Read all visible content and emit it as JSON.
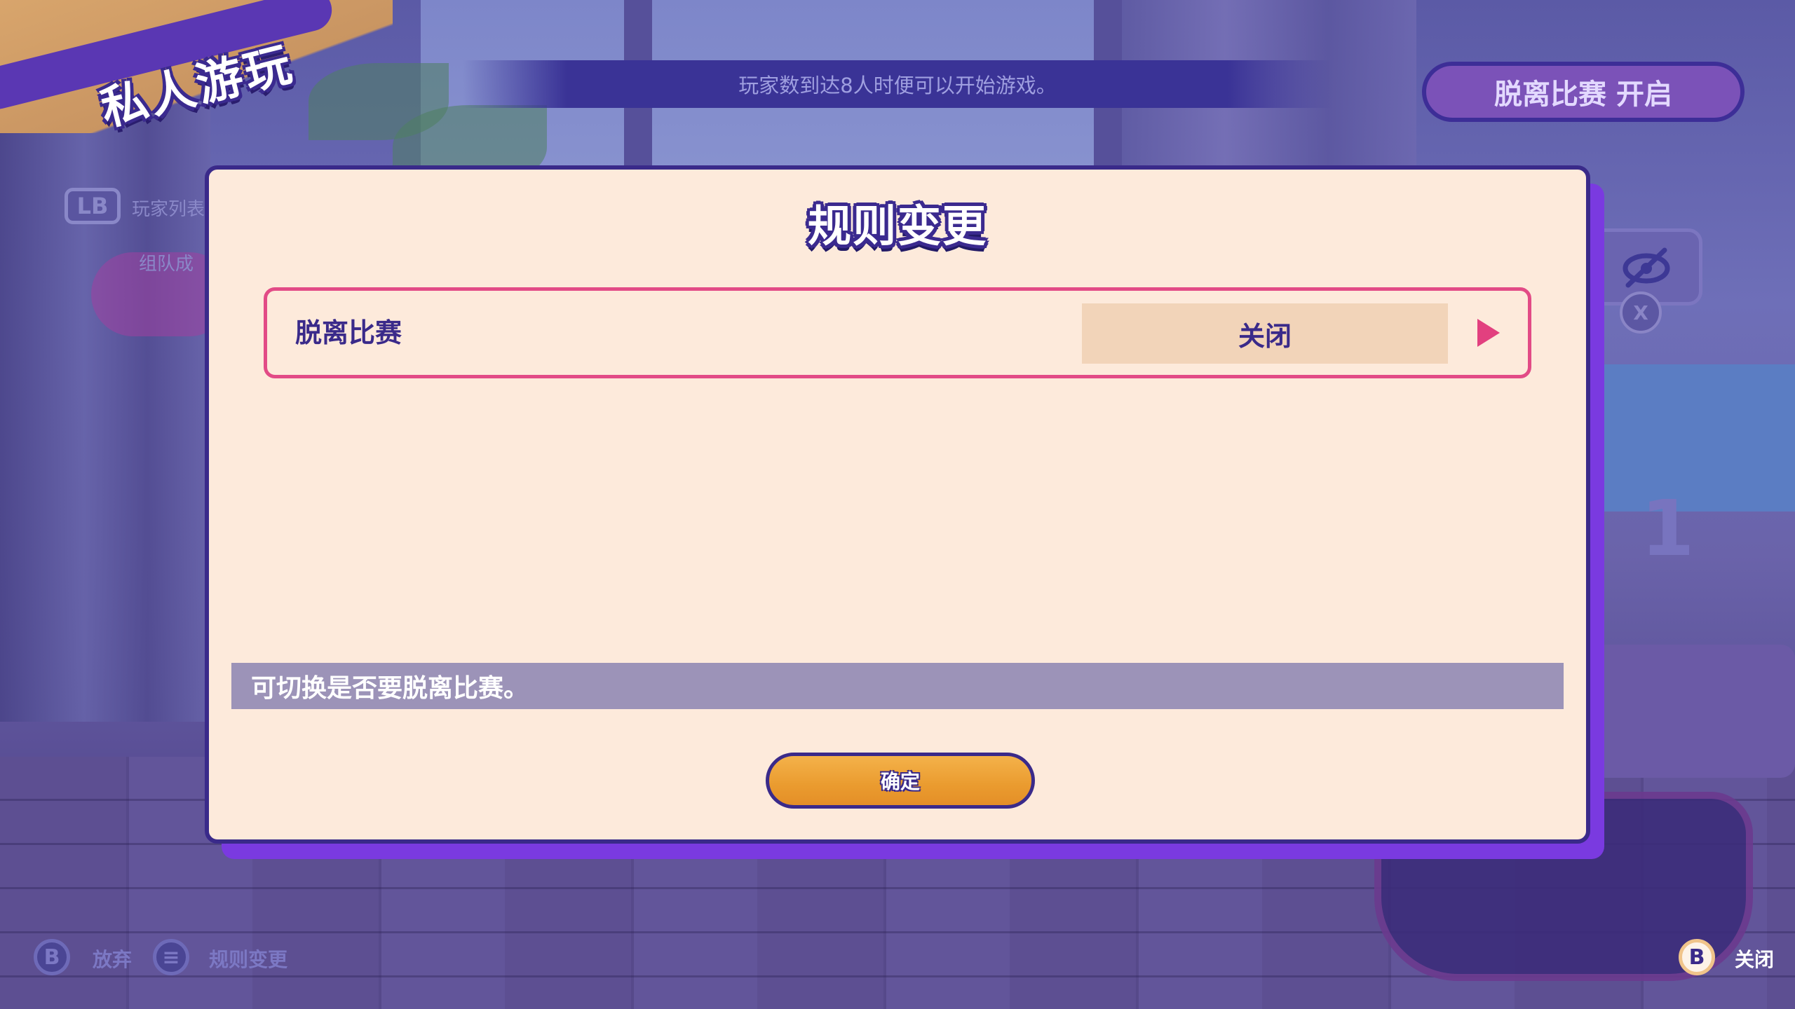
{
  "header": {
    "title": "私人游玩",
    "info_message": "玩家数到达8人时便可以开始游戏。",
    "tournament_status": "脱离比赛 开启"
  },
  "sidebar": {
    "lb_button": "LB",
    "player_list_label": "玩家列表",
    "team_label": "组队成"
  },
  "right_panel": {
    "x_badge": "X",
    "counter": "1"
  },
  "dialog": {
    "title": "规则变更",
    "rule": {
      "label": "脱离比赛",
      "value": "关闭"
    },
    "description": "可切换是否要脱离比赛。",
    "confirm_label": "确定"
  },
  "footer": {
    "left_prompts": [
      {
        "button": "B",
        "label": "放弃"
      },
      {
        "button": "≡",
        "label": "规则变更"
      }
    ],
    "right_prompt": {
      "button": "B",
      "label": "关闭"
    }
  },
  "colors": {
    "dialog_bg": "#fdeadb",
    "accent_pink": "#e24b86",
    "outline_purple": "#3a2a8a",
    "confirm_orange": "#ea9b2f"
  }
}
